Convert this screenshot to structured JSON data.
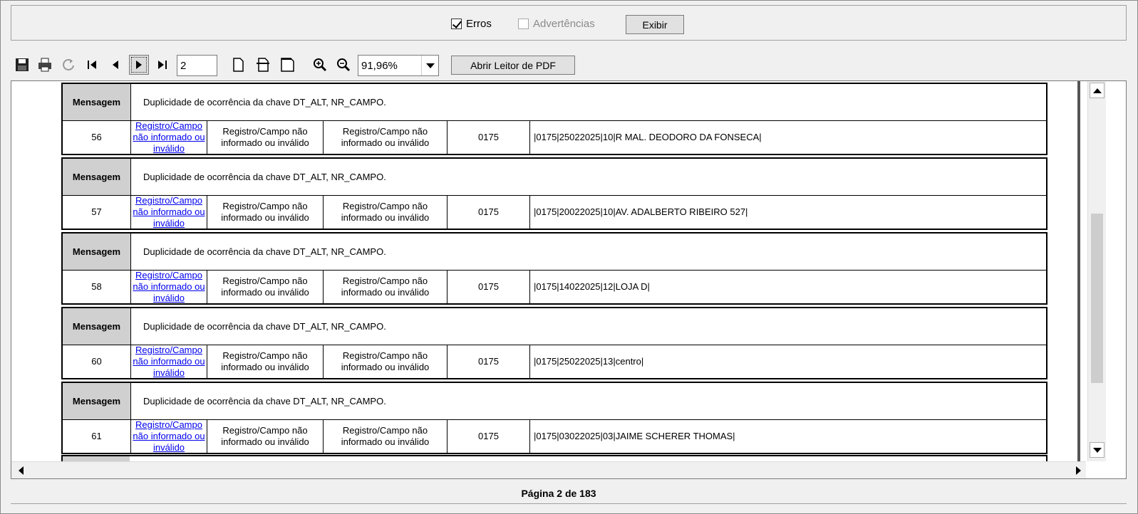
{
  "filter": {
    "erros_label": "Erros",
    "erros_checked": true,
    "advertencias_label": "Advertências",
    "advertencias_checked": false,
    "exibir_label": "Exibir"
  },
  "toolbar": {
    "icons": [
      "save-icon",
      "print-icon",
      "refresh-icon",
      "first-page-icon",
      "previous-page-icon",
      "next-page-icon",
      "last-page-icon",
      "actual-size-icon",
      "fit-page-icon",
      "fit-width-icon",
      "zoom-in-icon",
      "zoom-out-icon"
    ],
    "page_value": "2",
    "zoom_value": "91,96%",
    "open_pdf_label": "Abrir Leitor de PDF"
  },
  "report": {
    "message_label": "Mensagem",
    "records": [
      {
        "message": "Duplicidade de ocorrência da chave DT_ALT, NR_CAMPO.",
        "number": "56",
        "link": "Registro/Campo não informado ou inválido",
        "desc1": "Registro/Campo não informado ou inválido",
        "desc2": "Registro/Campo não informado ou inválido",
        "register": "0175",
        "line": "|0175|25022025|10|R MAL. DEODORO DA FONSECA|"
      },
      {
        "message": "Duplicidade de ocorrência da chave DT_ALT, NR_CAMPO.",
        "number": "57",
        "link": "Registro/Campo não informado ou inválido",
        "desc1": "Registro/Campo não informado ou inválido",
        "desc2": "Registro/Campo não informado ou inválido",
        "register": "0175",
        "line": "|0175|20022025|10|AV. ADALBERTO RIBEIRO 527|"
      },
      {
        "message": "Duplicidade de ocorrência da chave DT_ALT, NR_CAMPO.",
        "number": "58",
        "link": "Registro/Campo não informado ou inválido",
        "desc1": "Registro/Campo não informado ou inválido",
        "desc2": "Registro/Campo não informado ou inválido",
        "register": "0175",
        "line": "|0175|14022025|12|LOJA D|"
      },
      {
        "message": "Duplicidade de ocorrência da chave DT_ALT, NR_CAMPO.",
        "number": "60",
        "link": "Registro/Campo não informado ou inválido",
        "desc1": "Registro/Campo não informado ou inválido",
        "desc2": "Registro/Campo não informado ou inválido",
        "register": "0175",
        "line": "|0175|25022025|13|centro|"
      },
      {
        "message": "Duplicidade de ocorrência da chave DT_ALT, NR_CAMPO.",
        "number": "61",
        "link": "Registro/Campo não informado ou inválido",
        "desc1": "Registro/Campo não informado ou inválido",
        "desc2": "Registro/Campo não informado ou inválido",
        "register": "0175",
        "line": "|0175|03022025|03|JAIME SCHERER THOMAS|"
      }
    ]
  },
  "status": {
    "page_text": "Página 2 de 183"
  },
  "colors": {
    "message_label_bg": "#d0d0d0",
    "link": "#0000ee"
  }
}
